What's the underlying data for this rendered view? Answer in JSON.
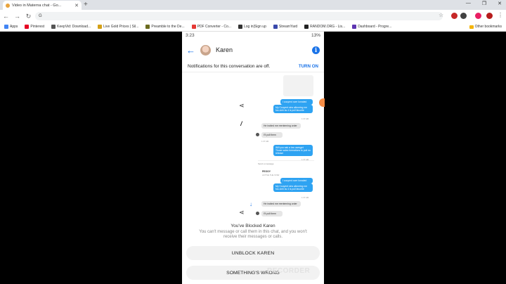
{
  "browser": {
    "tab_title": "Video in Materna chat - Go...",
    "omnibox_value": "G",
    "window_controls": [
      "—",
      "❐",
      "✕"
    ],
    "bookmarks": [
      {
        "label": "Apps",
        "color": "#4285f4"
      },
      {
        "label": "Pinterest",
        "color": "#e60023"
      },
      {
        "label": "KeepVid: Download...",
        "color": "#555555"
      },
      {
        "label": "Live Gold Prices | Sil...",
        "color": "#d4a017"
      },
      {
        "label": "Preamble to the De...",
        "color": "#6b6b1f"
      },
      {
        "label": "PDF Converter - Co...",
        "color": "#e53935"
      },
      {
        "label": "Log in|Sign up",
        "color": "#333333"
      },
      {
        "label": "StreamYard",
        "color": "#3949ab"
      },
      {
        "label": "RANDOM.ORG - Lis...",
        "color": "#222222"
      },
      {
        "label": "Dashboard - Progre...",
        "color": "#5e35b1"
      }
    ],
    "other_bookmarks": "Other bookmarks",
    "extension_colors": [
      "#c62828",
      "#424242",
      "#e91e63",
      "#b71c1c"
    ]
  },
  "phone": {
    "status": {
      "time": "3:23",
      "right": "13%"
    },
    "contact_name": "Karen",
    "notification_text": "Notifications for this conversation are off.",
    "turn_on_label": "TURN ON",
    "chat": {
      "msg1": "I couyent over lonnded",
      "msg2": "My Couyent sins alloveing me fos oinh ks 4 is pull favorite",
      "t1": "1:37 AM",
      "msg3": "He incited me reenterning order",
      "msg4": "I'll pull them",
      "t2": "1:37 AM",
      "msg5": "Will you ask a low usesget Those sales formations to pull no release",
      "t3": "1:37 AM",
      "compose_placeholder": "Send a message",
      "peggy_name": "PEGGY",
      "peggy_sub": "ACTIVE THE STAR",
      "msg6": "I couyent over lonnded",
      "msg7": "My Couyent sins alloveing me fos oinh ks 4 is pull favorite",
      "t4": "1:37 AM",
      "msg8": "He incited me reenterning order",
      "msg9": "I'll pull them"
    },
    "blocked_title": "You've Blocked Karen",
    "blocked_message": "You can't message or call them in this chat, and you won't receive their messages or calls.",
    "unblock_label": "UNBLOCK KAREN",
    "wrong_label": "SOMETHING'S WRONG"
  },
  "watermark": "RECORDER",
  "colors": {
    "accent": "#1a73e8",
    "bubble": "#2ea3f2"
  }
}
